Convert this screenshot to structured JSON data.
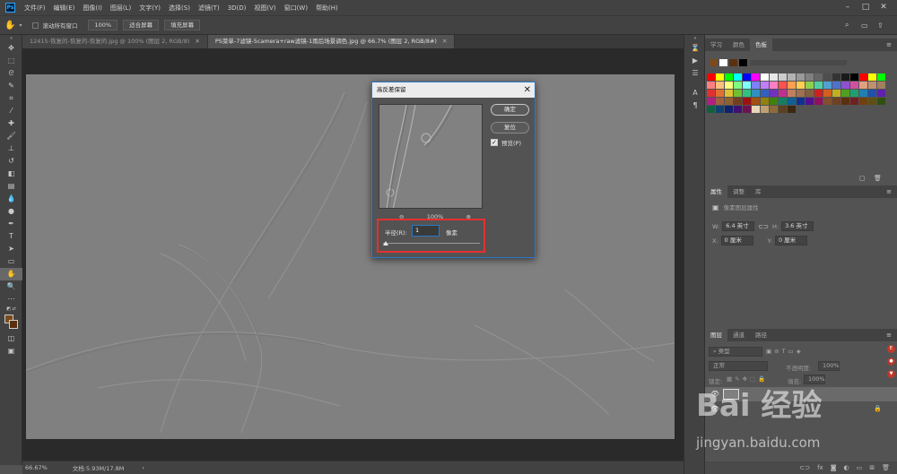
{
  "app": {
    "logo_label": "Ps",
    "menu": [
      "文件(F)",
      "编辑(E)",
      "图像(I)",
      "图层(L)",
      "文字(Y)",
      "选择(S)",
      "滤镜(T)",
      "3D(D)",
      "视图(V)",
      "窗口(W)",
      "帮助(H)"
    ]
  },
  "options_bar": {
    "scroll_all_label": "滚动所有窗口",
    "zoom_100": "100%",
    "fit_screen": "适合屏幕",
    "fill_screen": "填充屏幕"
  },
  "tabs": [
    {
      "label": "12415-恢复的-恢复的-恢复的.jpg @ 100% (图层 2, RGB/8)",
      "active": false
    },
    {
      "label": "PS菜单-7滤镜-5camera+raw滤镜-1雨后场景调色.jpg @ 66.7% (图层 2, RGB/8#)",
      "active": true
    }
  ],
  "status_bar": {
    "zoom": "66.67%",
    "doc_info": "文档:5.93M/17.8M"
  },
  "dialog": {
    "title": "高反差保留",
    "ok": "确定",
    "reset": "复位",
    "preview_label": "预览(P)",
    "preview_checked": true,
    "zoom_level": "100%",
    "radius_label": "半径(R):",
    "radius_value": "1",
    "radius_unit": "像素",
    "radius_slider_level": 0.0
  },
  "right_panel": {
    "top_tabs": [
      "学习",
      "颜色",
      "色板"
    ],
    "top_tab_active": 2,
    "properties_tabs": [
      "属性",
      "调整",
      "库"
    ],
    "properties_tab_active": 0,
    "pixel_layer_label": "像素图层属性",
    "w_label": "W:",
    "w_value": "6.4 英寸",
    "h_label": "H:",
    "h_value": "3.6 英寸",
    "x_label": "X:",
    "x_value": "0 厘米",
    "y_label": "Y:",
    "y_value": "0 厘米",
    "layers_tabs": [
      "图层",
      "通道",
      "路径"
    ],
    "layers_tab_active": 0,
    "kind_label": "类型",
    "blend_mode": "正常",
    "opacity_label": "不透明度:",
    "opacity_value": "100%",
    "lock_label": "锁定:",
    "fill_label": "填充:",
    "fill_value": "100%"
  },
  "swatch_colors": [
    "#ff0000",
    "#ffff00",
    "#00ff00",
    "#00ffff",
    "#0000ff",
    "#ff00ff",
    "#ffffff",
    "#e6e6e6",
    "#cccccc",
    "#b3b3b3",
    "#999999",
    "#808080",
    "#666666",
    "#4d4d4d",
    "#333333",
    "#1a1a1a",
    "#000000",
    "#ff0000",
    "#ffff00",
    "#00ff00",
    "#ff7f7f",
    "#ffbf7f",
    "#ffff7f",
    "#7fff7f",
    "#7fffff",
    "#7f7fff",
    "#bf7fff",
    "#ff7fbf",
    "#ff5050",
    "#ffa050",
    "#ffd050",
    "#90d050",
    "#50d0a0",
    "#50a0d0",
    "#5070d0",
    "#9050d0",
    "#d050a0",
    "#e0a080",
    "#c09070",
    "#a08060",
    "#e03030",
    "#e07030",
    "#e0c030",
    "#70c030",
    "#30c080",
    "#3090c0",
    "#3060c0",
    "#7030c0",
    "#c03090",
    "#c08060",
    "#a07050",
    "#806040",
    "#d02020",
    "#d06020",
    "#c0b020",
    "#50a020",
    "#20a070",
    "#2080b0",
    "#2050b0",
    "#6020b0",
    "#b02080",
    "#a06040",
    "#906030",
    "#704020",
    "#a01010",
    "#a05010",
    "#908010",
    "#408010",
    "#108060",
    "#106090",
    "#103090",
    "#501090",
    "#901060",
    "#805030",
    "#704020",
    "#5a3010",
    "#702020",
    "#704010",
    "#605010",
    "#305010",
    "#106040",
    "#104070",
    "#102070",
    "#401070",
    "#701050",
    "#e8d8b8",
    "#c0a070",
    "#8c6c3c",
    "#5c4020",
    "#3a2810"
  ],
  "watermark": {
    "logo": "Bai 经验",
    "url": "jingyan.baidu.com"
  }
}
